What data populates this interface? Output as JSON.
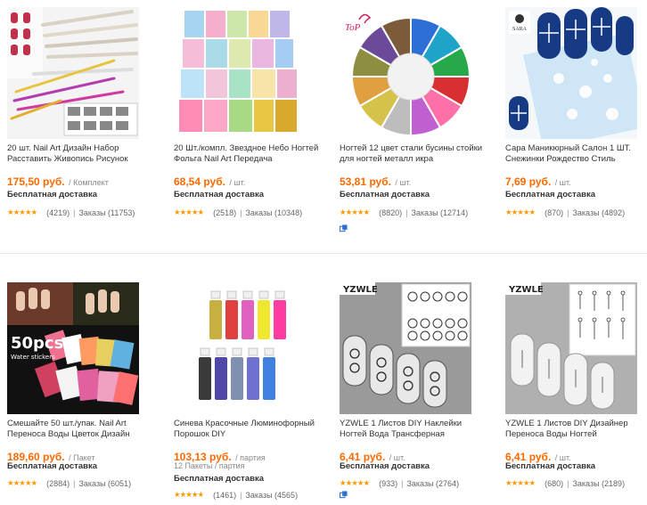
{
  "products": [
    {
      "title": "20 шт. Nail Art Дизайн Набор Расставить Живопись Рисунок",
      "price": "175,50 руб.",
      "unit": "/ Комплект",
      "subunit": "",
      "shipping": "Бесплатная доставка",
      "reviews": "(4219)",
      "orders": "Заказы (11753)",
      "stars": "★★★★★",
      "thumb": "brushes-image",
      "wishlist": false
    },
    {
      "title": "20 Шт./компл. Звездное Небо Ногтей Фольга Nail Art Передача",
      "price": "68,54 руб.",
      "unit": "/ шт.",
      "subunit": "",
      "shipping": "Бесплатная доставка",
      "reviews": "(2518)",
      "orders": "Заказы (10348)",
      "stars": "★★★★★",
      "thumb": "foil-image",
      "wishlist": false
    },
    {
      "title": "Ногтей 12 цвет стали бусины стойки для ногтей металл икра",
      "price": "53,81 руб.",
      "unit": "/ шт.",
      "subunit": "",
      "shipping": "Бесплатная доставка",
      "reviews": "(8820)",
      "orders": "Заказы (12714)",
      "stars": "★★★★★",
      "thumb": "beads-wheel-image",
      "brand": "ToP",
      "wishlist": true
    },
    {
      "title": "Сара Маникюрный Салон 1 ШТ. Снежинки Рождество Стиль",
      "price": "7,69 руб.",
      "unit": "/ шт.",
      "subunit": "",
      "shipping": "Бесплатная доставка",
      "reviews": "(870)",
      "orders": "Заказы (4892)",
      "stars": "★★★★★",
      "thumb": "snowflake-stickers-image",
      "brand": "SARA",
      "wishlist": false
    },
    {
      "title": "Смешайте 50 шт./упак. Nail Art Переноса Воды Цветок Дизайн",
      "price": "189,60 руб.",
      "unit": "/ Пакет",
      "subunit": "",
      "shipping": "Бесплатная доставка",
      "reviews": "(2884)",
      "orders": "Заказы (6051)",
      "stars": "★★★★★",
      "thumb": "water-stickers-image",
      "badge_main": "50pcs",
      "badge_sub": "Water stickers",
      "wishlist": false
    },
    {
      "title": "Синева Красочные Люминофорный Порошок DIY",
      "price": "103,13 руб.",
      "unit": "/ партия",
      "subunit": "12 Пакеты / партия",
      "shipping": "Бесплатная доставка",
      "reviews": "(1461)",
      "orders": "Заказы (4565)",
      "stars": "★★★★★",
      "thumb": "glitter-bottles-image",
      "wishlist": false
    },
    {
      "title": "YZWLE 1 Листов DIY Наклейки Ногтей Вода Трансферная",
      "price": "6,41 руб.",
      "unit": "/ шт.",
      "subunit": "",
      "shipping": "Бесплатная доставка",
      "reviews": "(933)",
      "orders": "Заказы (2764)",
      "stars": "★★★★★",
      "thumb": "yzwle-lace-image",
      "brand": "YZWLE",
      "wishlist": true
    },
    {
      "title": "YZWLE 1 Листов DIY Дизайнер Переноса Воды Ногтей",
      "price": "6,41 руб.",
      "unit": "/ шт.",
      "subunit": "",
      "shipping": "Бесплатная доставка",
      "reviews": "(680)",
      "orders": "Заказы (2189)",
      "stars": "★★★★★",
      "thumb": "yzwle-dandelion-image",
      "brand": "YZWLE",
      "wishlist": false
    }
  ],
  "colors": {
    "price": "#ff6a00",
    "stars": "#ff9a00",
    "wishlist": "#2b6fd6"
  }
}
